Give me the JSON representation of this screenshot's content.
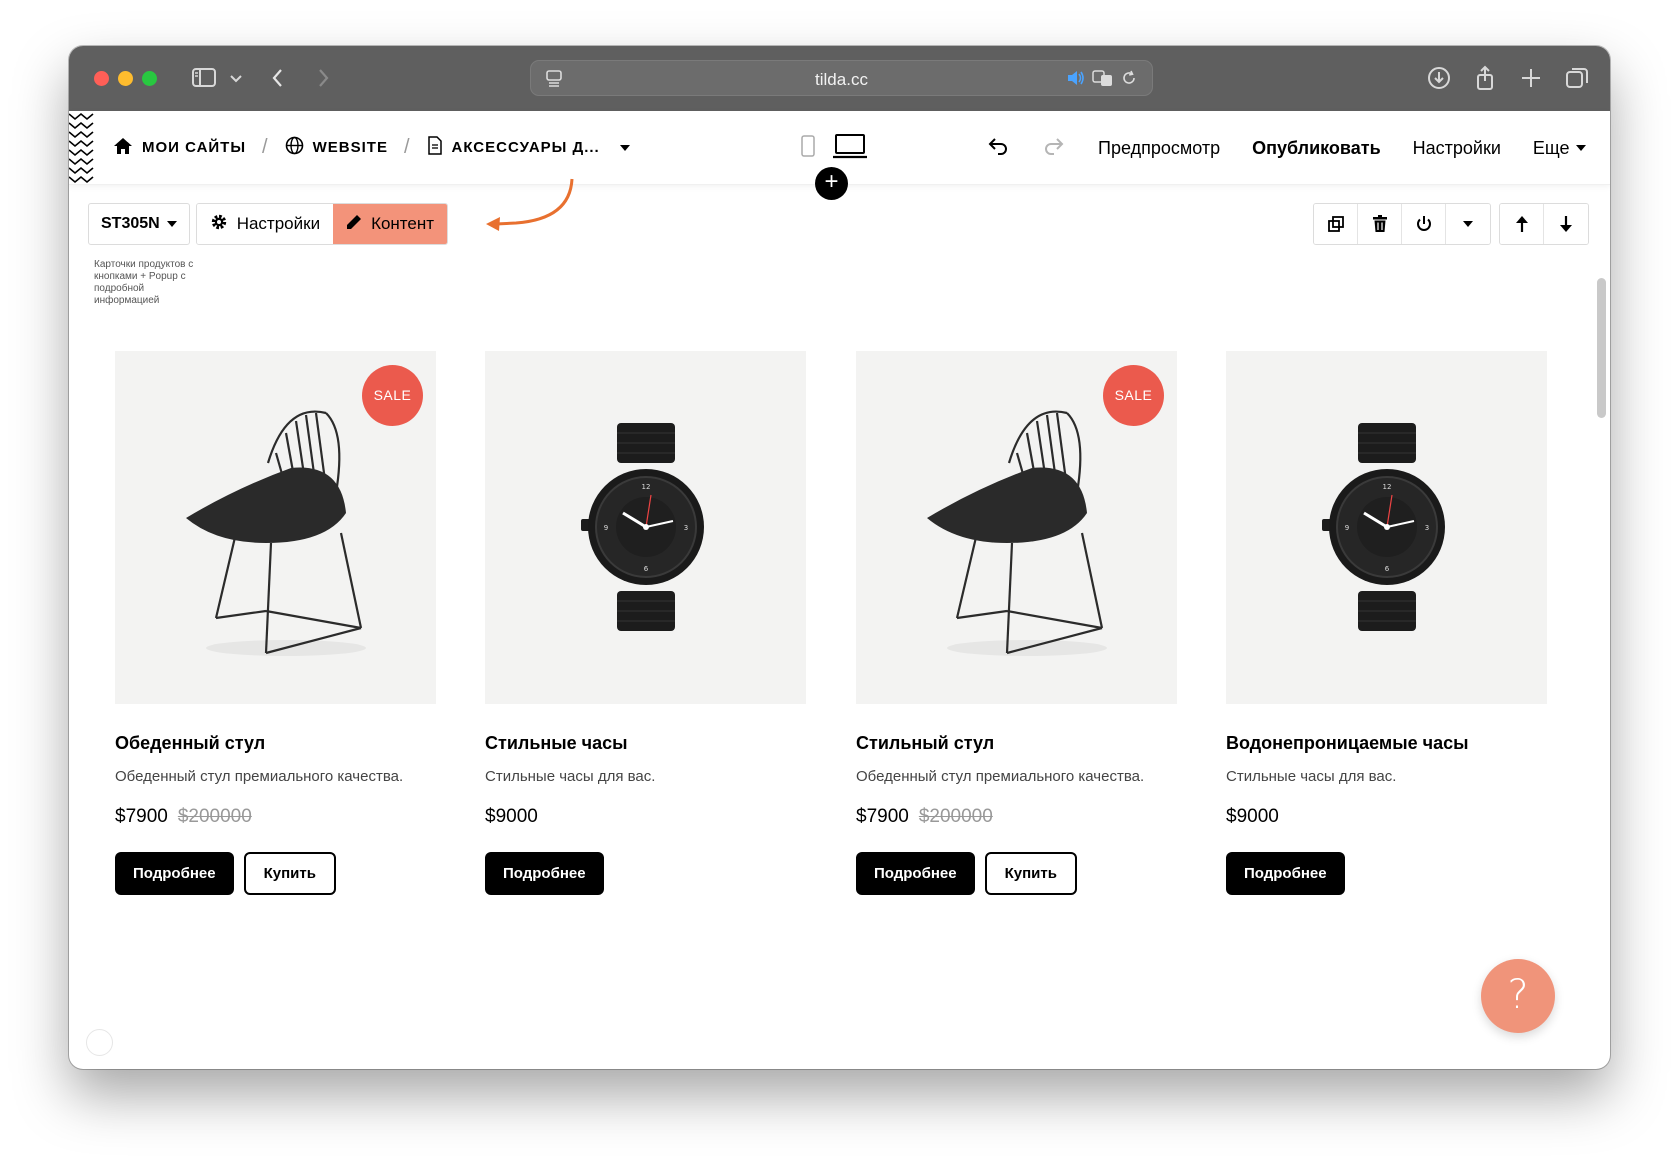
{
  "browser": {
    "url": "tilda.cc"
  },
  "topbar": {
    "breadcrumbs": [
      {
        "label": "МОИ САЙТЫ",
        "icon": "home-icon"
      },
      {
        "label": "WEBSITE",
        "icon": "globe-icon"
      },
      {
        "label": "АКСЕССУАРЫ Д...",
        "icon": "page-icon"
      }
    ],
    "actions": {
      "preview": "Предпросмотр",
      "publish": "Опубликовать",
      "settings": "Настройки",
      "more": "Еще"
    }
  },
  "block": {
    "code": "ST305N",
    "settings_label": "Настройки",
    "content_label": "Контент",
    "description": "Карточки продуктов с кнопками + Popup с подробной информацией",
    "accent_color": "#f3937a",
    "arrow_color": "#e8702f"
  },
  "products": [
    {
      "title": "Обеденный стул",
      "description": "Обеденный стул премиального качества.",
      "price": "$7900",
      "old_price": "$200000",
      "sale_label": "SALE",
      "more_label": "Подробнее",
      "buy_label": "Купить",
      "image": "chair"
    },
    {
      "title": "Стильные часы",
      "description": "Стильные часы для вас.",
      "price": "$9000",
      "old_price": "",
      "sale_label": "",
      "more_label": "Подробнее",
      "buy_label": "",
      "image": "watch"
    },
    {
      "title": "Стильный стул",
      "description": "Обеденный стул премиального качества.",
      "price": "$7900",
      "old_price": "$200000",
      "sale_label": "SALE",
      "more_label": "Подробнее",
      "buy_label": "Купить",
      "image": "chair"
    },
    {
      "title": "Водонепроницаемые часы",
      "description": "Стильные часы для вас.",
      "price": "$9000",
      "old_price": "",
      "sale_label": "",
      "more_label": "Подробнее",
      "buy_label": "",
      "image": "watch"
    }
  ],
  "help": {
    "label": "?"
  },
  "colors": {
    "sale_badge": "#eb5a4d",
    "help_button": "#f0947a",
    "chrome": "#5f5f5f"
  }
}
